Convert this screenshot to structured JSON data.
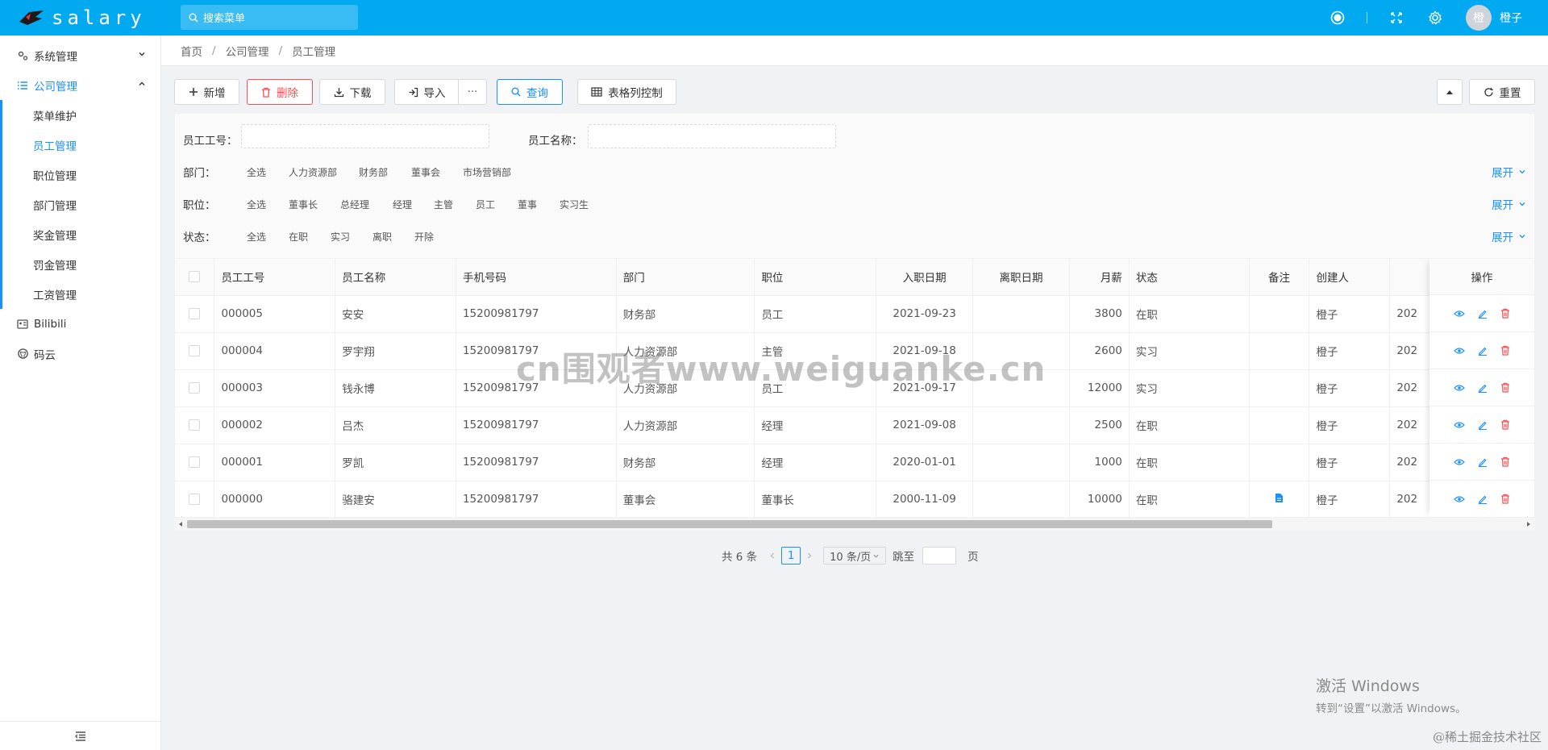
{
  "header": {
    "app_name": "salary",
    "search_placeholder": "搜索菜单",
    "avatar_char": "橙",
    "username": "橙子"
  },
  "sidebar": {
    "items": [
      {
        "label": "系统管理"
      },
      {
        "label": "公司管理"
      },
      {
        "label": "Bilibili"
      },
      {
        "label": "码云"
      }
    ],
    "company_sub": [
      "菜单维护",
      "员工管理",
      "职位管理",
      "部门管理",
      "奖金管理",
      "罚金管理",
      "工资管理"
    ]
  },
  "breadcrumb": [
    "首页",
    "公司管理",
    "员工管理"
  ],
  "toolbar": {
    "add": "新增",
    "delete": "删除",
    "download": "下载",
    "import": "导入",
    "more": "···",
    "query": "查询",
    "columns": "表格列控制",
    "reset": "重置"
  },
  "filter": {
    "emp_no_label": "员工工号：",
    "emp_name_label": "员工名称：",
    "dept_label": "部门：",
    "dept_options": [
      "全选",
      "人力资源部",
      "财务部",
      "董事会",
      "市场营销部"
    ],
    "pos_label": "职位：",
    "pos_options": [
      "全选",
      "董事长",
      "总经理",
      "经理",
      "主管",
      "员工",
      "董事",
      "实习生"
    ],
    "status_label": "状态：",
    "status_options": [
      "全选",
      "在职",
      "实习",
      "离职",
      "开除"
    ],
    "expand": "展开"
  },
  "table": {
    "headers": [
      "员工工号",
      "员工名称",
      "手机号码",
      "部门",
      "职位",
      "入职日期",
      "离职日期",
      "月薪",
      "状态",
      "备注",
      "创建人",
      "",
      "操作"
    ],
    "rows": [
      [
        "000005",
        "安安",
        "15200981797",
        "财务部",
        "员工",
        "2021-09-23",
        "",
        "3800",
        "在职",
        "",
        "橙子",
        "202"
      ],
      [
        "000004",
        "罗宇翔",
        "15200981797",
        "人力资源部",
        "主管",
        "2021-09-18",
        "",
        "2600",
        "实习",
        "",
        "橙子",
        "202"
      ],
      [
        "000003",
        "钱永博",
        "15200981797",
        "人力资源部",
        "员工",
        "2021-09-17",
        "",
        "12000",
        "实习",
        "",
        "橙子",
        "202"
      ],
      [
        "000002",
        "吕杰",
        "15200981797",
        "人力资源部",
        "经理",
        "2021-09-08",
        "",
        "2500",
        "在职",
        "",
        "橙子",
        "202"
      ],
      [
        "000001",
        "罗凯",
        "15200981797",
        "财务部",
        "经理",
        "2020-01-01",
        "",
        "1000",
        "在职",
        "",
        "橙子",
        "202"
      ],
      [
        "000000",
        "骆建安",
        "15200981797",
        "董事会",
        "董事长",
        "2000-11-09",
        "",
        "10000",
        "在职",
        "file-icon",
        "橙子",
        "202"
      ]
    ]
  },
  "pager": {
    "total": "共 6 条",
    "current": "1",
    "page_size": "10 条/页",
    "jump_label": "跳至",
    "page_suffix": "页"
  },
  "overlay": {
    "watermark": "cn围观者www.weiguanke.cn",
    "win_title": "激活 Windows",
    "win_sub": "转到“设置”以激活 Windows。",
    "footer": "@稀土掘金技术社区"
  },
  "colors": {
    "header": "#00a9f0",
    "accent": "#1890ff",
    "danger": "#ff4d4f"
  }
}
